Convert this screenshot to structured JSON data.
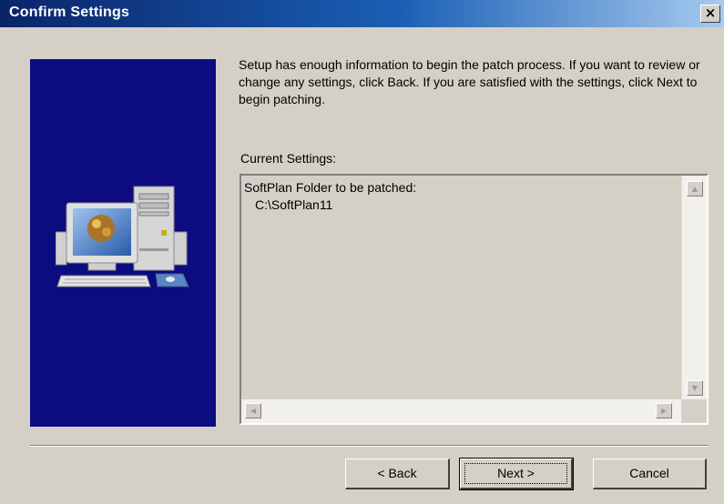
{
  "window": {
    "title": "Confirm Settings",
    "close_symbol": "×"
  },
  "side_panel": {
    "illustration": "computer-illustration-icon",
    "background_color": "#0c0c80"
  },
  "intro": {
    "text": "Setup has enough information to begin the patch process.  If you want to review or change any settings, click Back.  If you are satisfied with the settings, click Next to begin patching."
  },
  "current_settings": {
    "label": "Current Settings:",
    "lines": [
      "SoftPlan Folder to be patched:",
      "C:\\SoftPlan11"
    ]
  },
  "scrollbars": {
    "up": "▲",
    "down": "▼",
    "left": "◀",
    "right": "▶"
  },
  "buttons": {
    "back": "< Back",
    "next": "Next >",
    "cancel": "Cancel"
  }
}
